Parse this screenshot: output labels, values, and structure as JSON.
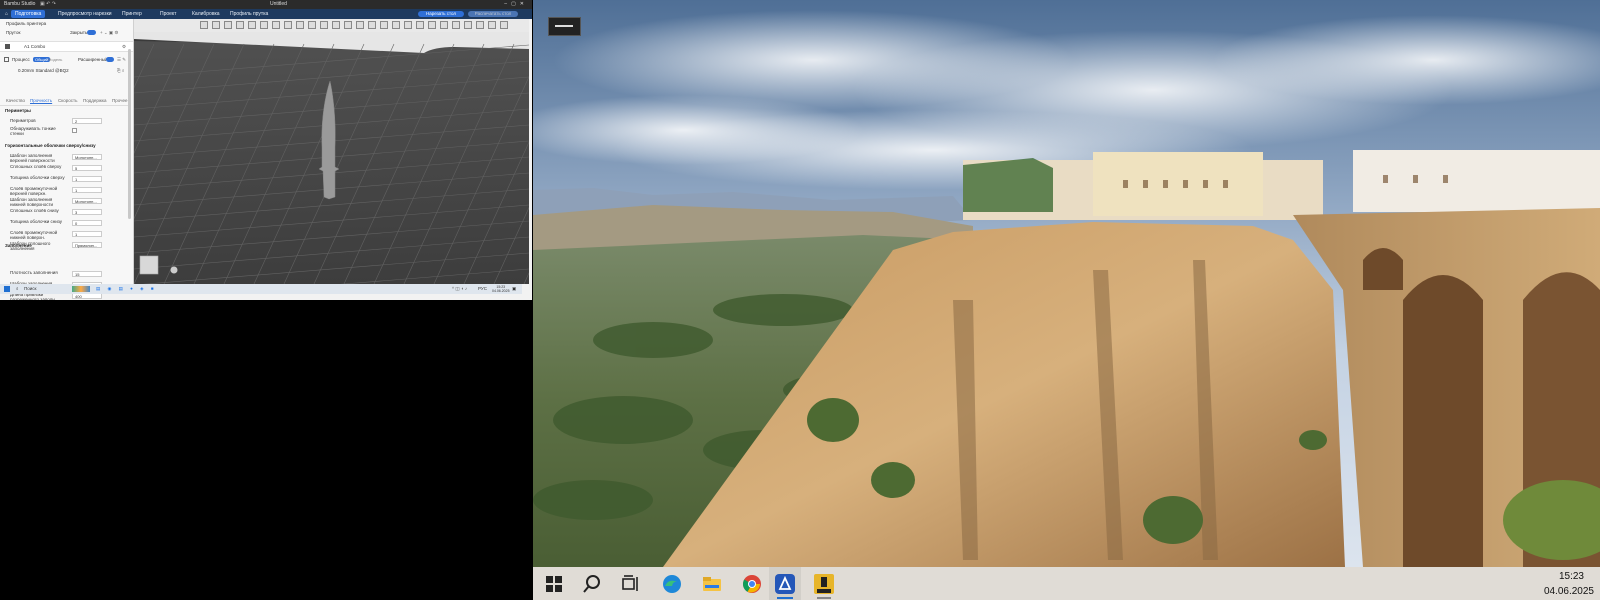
{
  "left_app": {
    "title_text": "Bambu Studio",
    "file_title": "Untitled",
    "menu_tabs": [
      "Подготовка",
      "Предпросмотр нарезки",
      "Принтер",
      "Проект",
      "Калибровка",
      "Профиль прутка"
    ],
    "slice_button": "Нарезать стол",
    "print_button": "Распечатать стол",
    "section_printer_profile": "Профиль принтера",
    "section_filament": "Пруток",
    "filament_toggle": "Закрыть",
    "printer_name": "A1 Combo",
    "process_label": "Процесс",
    "process_modes": [
      "Общий",
      "Модель"
    ],
    "advanced_label": "Расширенный",
    "profile_name": "0.20mm Standard @BQ2",
    "sub_tabs": [
      "Качество",
      "Прочность",
      "Скорость",
      "Поддержка",
      "Прочее"
    ],
    "active_sub_tab": "Прочность",
    "group_params": "Периметры",
    "params": [
      {
        "label": "Периметров",
        "value": "2"
      },
      {
        "label": "Обнаруживать тонкие стенки",
        "value": ""
      }
    ],
    "group_shells": "Горизонтальные оболочки сверху/снизу",
    "shells": [
      {
        "label": "Шаблон заполнения верхней поверхности",
        "value": "Монотонн..."
      },
      {
        "label": "Сплошных слоёв сверху",
        "value": "5"
      },
      {
        "label": "Толщина оболочки сверху",
        "value": "1"
      },
      {
        "label": "Слоёв промежуточной верхней поверхн.",
        "value": "1"
      },
      {
        "label": "Шаблон заполнения нижней поверхности",
        "value": "Монотонн..."
      },
      {
        "label": "Сплошных слоёв снизу",
        "value": "3"
      },
      {
        "label": "Толщина оболочки снизу",
        "value": "0"
      },
      {
        "label": "Слоёв промежуточной нижней поверхн.",
        "value": "1"
      },
      {
        "label": "Шаблон сплошного заполнения",
        "value": "Прямолин..."
      }
    ],
    "group_infill": "Заполнение",
    "infill": [
      {
        "label": "Плотность заполнения",
        "value": "15"
      },
      {
        "label": "Шаблон заполнения",
        "value": "Сетка"
      },
      {
        "label": "Длина привязки разреженного заполн.",
        "value": "400"
      }
    ],
    "taskbar_search": "Поиск",
    "tray_lang": "РУС",
    "tray_time": "15:23",
    "tray_date": "04.06.2025"
  },
  "desktop": {
    "clock_time": "15:23",
    "clock_date": "04.06.2025",
    "taskbar_icons": [
      "windows-start-icon",
      "search-icon",
      "task-view-icon",
      "edge-icon",
      "file-explorer-icon",
      "chrome-icon",
      "bambu-studio-icon",
      "pro-app-icon"
    ]
  }
}
